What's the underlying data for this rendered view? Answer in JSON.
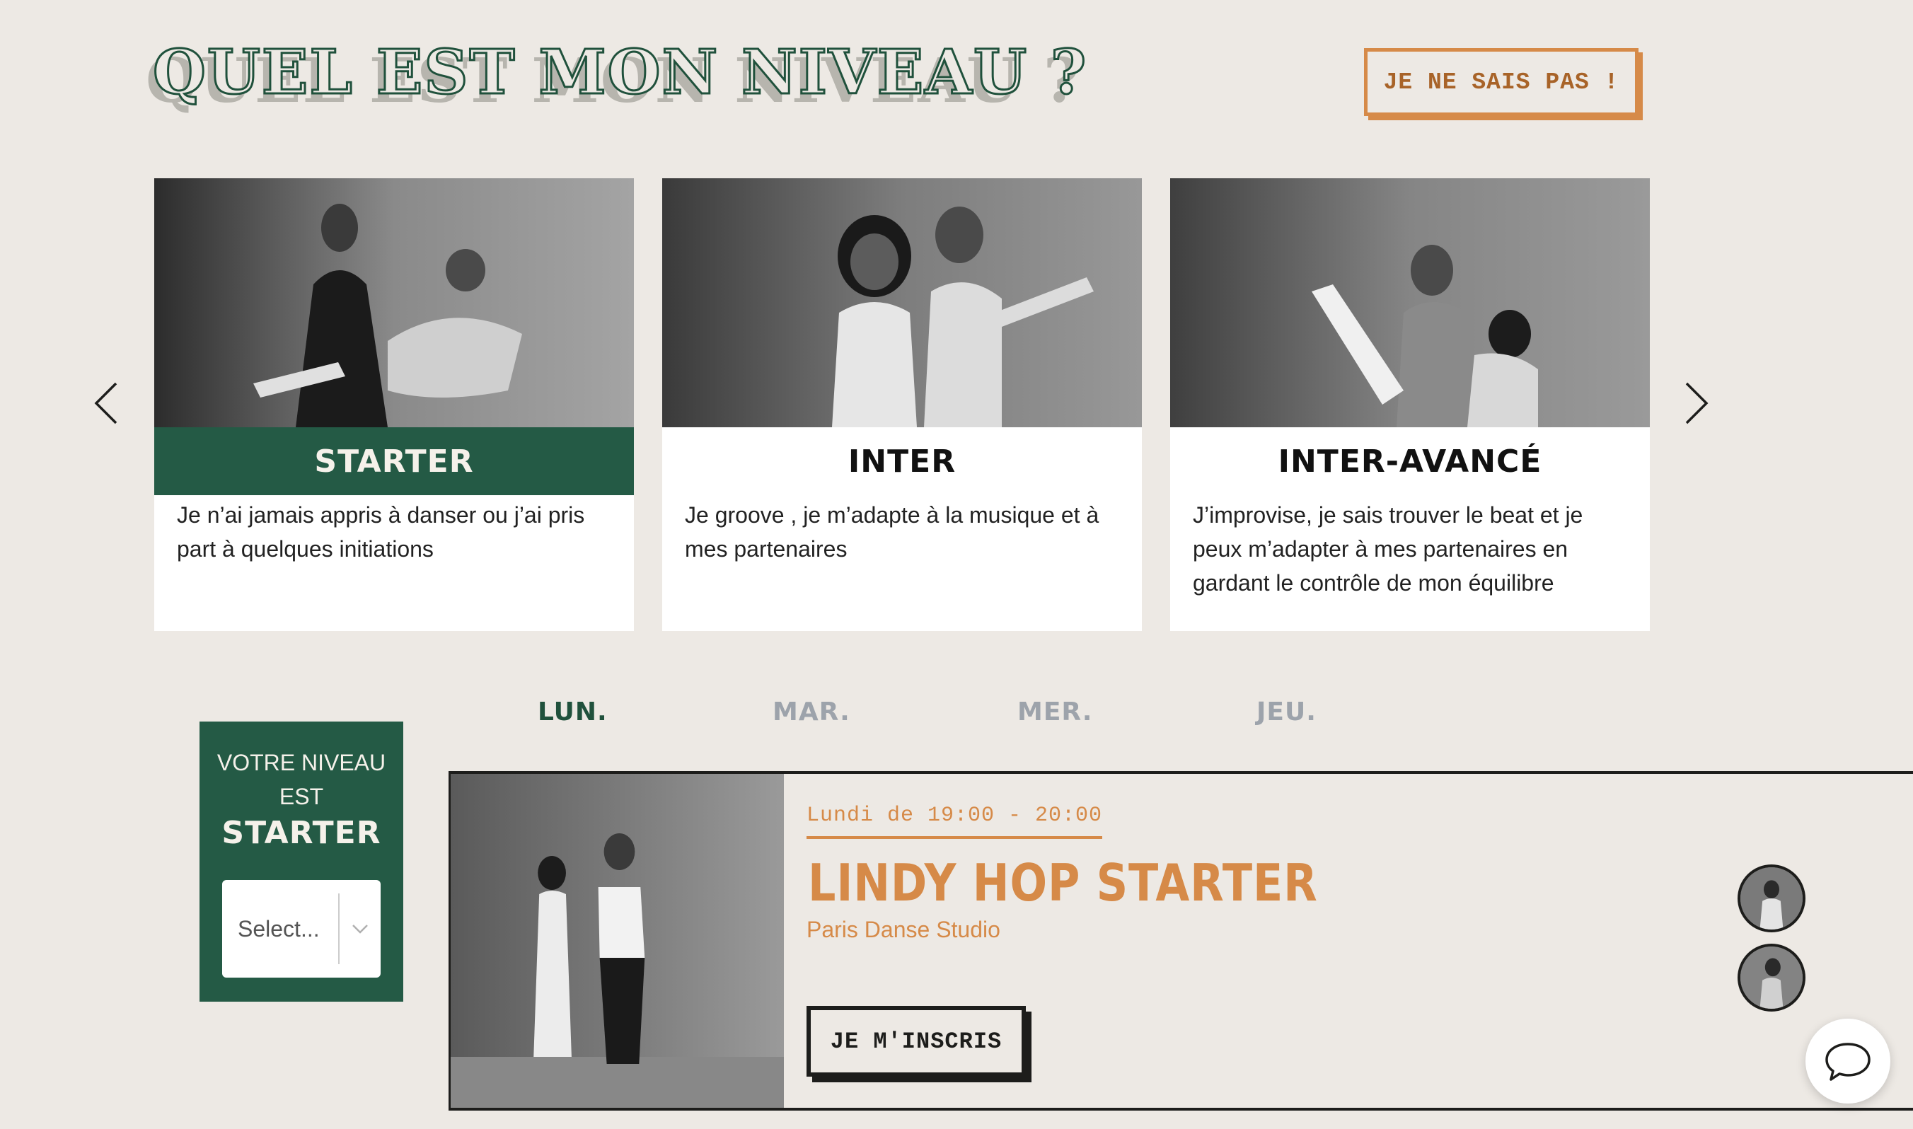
{
  "header": {
    "title": "QUEL EST MON NIVEAU ?",
    "help_button_label": "JE NE SAIS PAS !"
  },
  "carousel": {
    "prev_icon": "chevron-left-icon",
    "next_icon": "chevron-right-icon",
    "cards": [
      {
        "heading": "STARTER",
        "text": "Je n’ai jamais appris à danser ou j’ai pris part à quelques initiations",
        "active": true
      },
      {
        "heading": "INTER",
        "text": "Je groove , je m’adapte à la musique et à mes partenaires",
        "active": false
      },
      {
        "heading": "INTER-AVANCÉ",
        "text": "J’improvise, je sais trouver le beat et je peux m’adapter à mes partenaires en gardant le contrôle de mon équilibre",
        "active": false
      }
    ]
  },
  "days": [
    {
      "label": "LUN.",
      "active": true
    },
    {
      "label": "MAR.",
      "active": false
    },
    {
      "label": "MER.",
      "active": false
    },
    {
      "label": "JEU.",
      "active": false
    }
  ],
  "level_panel": {
    "label": "VOTRE NIVEAU EST",
    "level": "STARTER",
    "select_value": "Select..."
  },
  "class_item": {
    "time": "Lundi de 19:00 - 20:00",
    "name": "LINDY HOP STARTER",
    "venue": "Paris Danse Studio",
    "signup_label": "JE M'INSCRIS"
  },
  "colors": {
    "background": "#ede9e4",
    "brand_green": "#245a45",
    "accent_orange": "#d68a48",
    "inactive_day": "#9da3ab"
  },
  "chat_icon": "chat-bubble-icon"
}
